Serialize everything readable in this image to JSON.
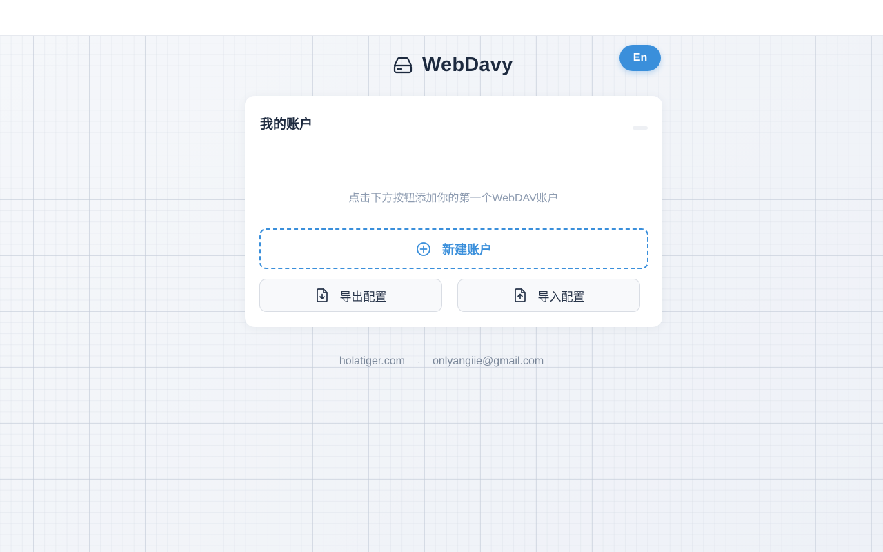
{
  "brand": {
    "title": "WebDavy",
    "icon": "hard-drive-icon"
  },
  "language_toggle": {
    "label": "En"
  },
  "accounts_card": {
    "title": "我的账户",
    "empty_hint": "点击下方按钮添加你的第一个WebDAV账户",
    "new_account_label": "新建账户",
    "new_account_icon": "plus-circle-icon",
    "export_label": "导出配置",
    "export_icon": "file-download-icon",
    "import_label": "导入配置",
    "import_icon": "file-upload-icon"
  },
  "footer": {
    "website": "holatiger.com",
    "separator": "·",
    "email": "onlyangiie@gmail.com"
  },
  "colors": {
    "accent": "#3a8fdb",
    "title_text": "#1d2a3f",
    "muted_text": "#8d9bb0",
    "background": "#f3f5f9"
  }
}
